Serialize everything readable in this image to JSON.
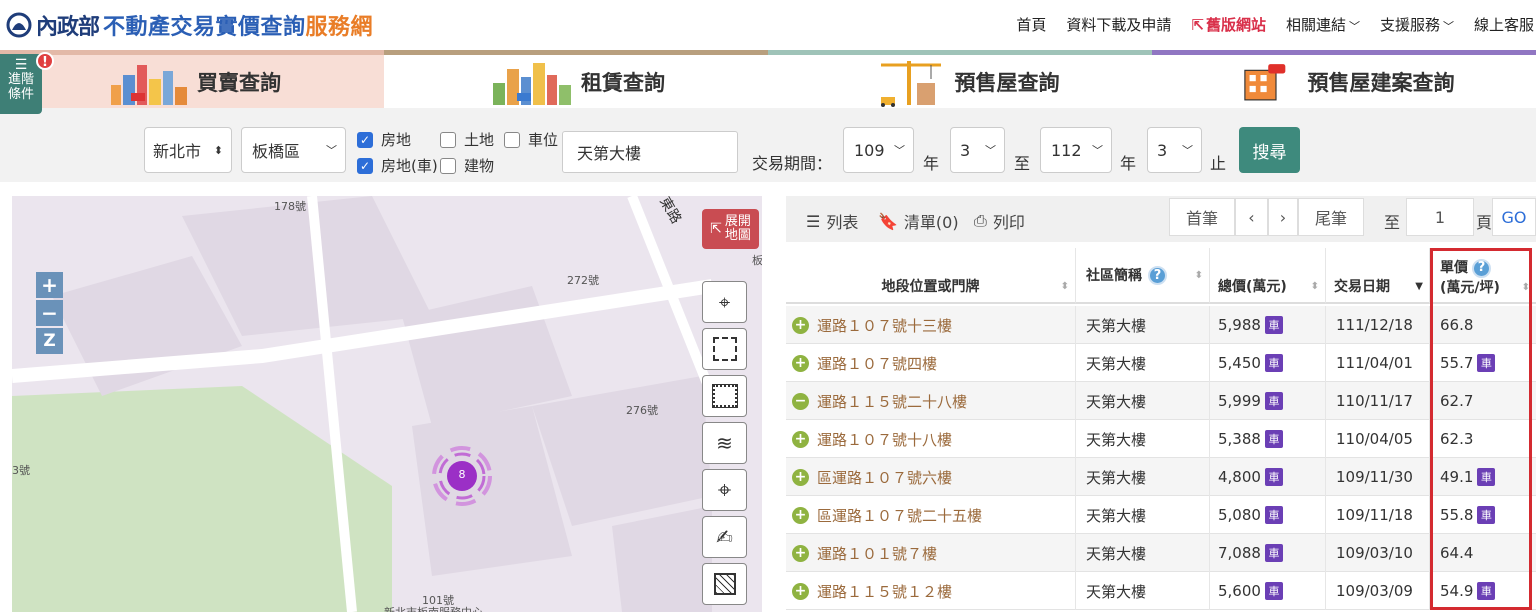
{
  "header": {
    "ministry": "內政部",
    "title_main": "不動產交易實價查詢",
    "title_accent": "服務網",
    "nav": {
      "home": "首頁",
      "download": "資料下載及申請",
      "old_site": "舊版網站",
      "links": "相關連結",
      "support": "支援服務",
      "service": "線上客服"
    }
  },
  "tabs": [
    {
      "label": "買賣查詢"
    },
    {
      "label": "租賃查詢"
    },
    {
      "label": "預售屋查詢"
    },
    {
      "label": "預售屋建案查詢"
    }
  ],
  "filter_button": {
    "label_line1": "進階",
    "label_line2": "條件",
    "badge": "!"
  },
  "search": {
    "city": "新北市",
    "district": "板橋區",
    "types": [
      {
        "label": "房地",
        "checked": true
      },
      {
        "label": "土地",
        "checked": false
      },
      {
        "label": "車位",
        "checked": false
      },
      {
        "label": "房地(車)",
        "checked": true
      },
      {
        "label": "建物",
        "checked": false
      }
    ],
    "keyword": "天第大樓",
    "period_label": "交易期間：",
    "start_year": "109",
    "start_month": "3",
    "end_year": "112",
    "end_month": "3",
    "year_unit": "年",
    "to": "至",
    "end": "止",
    "search_button": "搜尋"
  },
  "map": {
    "expand_label_1": "展開",
    "expand_label_2": "地圖",
    "zoom_in": "+",
    "zoom_out": "−",
    "zoom_z": "Z",
    "cluster_count": "8",
    "labels": {
      "l178": "178號",
      "l272": "272號",
      "l276": "276號",
      "l3": "3號",
      "l101": "101號",
      "road": "東路",
      "ban": "板",
      "bottom": "新北市板南服務中心"
    }
  },
  "panel": {
    "list": "列表",
    "bookmark": "清單(0)",
    "print": "列印",
    "first": "首筆",
    "prev": "‹",
    "next": "›",
    "last": "尾筆",
    "to": "至",
    "page": "1",
    "page_unit": "頁",
    "go": "GO"
  },
  "table": {
    "headers": {
      "address": "地段位置或門牌",
      "community": "社區簡稱",
      "total": "總價(萬元)",
      "date": "交易日期",
      "unit_line1": "單價",
      "unit_line2": "(萬元/坪)"
    },
    "car_label": "車",
    "rows": [
      {
        "address": "運路１０７號十三樓",
        "community": "天第大樓",
        "total": "5,988",
        "date": "111/12/18",
        "unit": "66.8",
        "unit_car": false,
        "minus": false
      },
      {
        "address": "運路１０７號四樓",
        "community": "天第大樓",
        "total": "5,450",
        "date": "111/04/01",
        "unit": "55.7",
        "unit_car": true,
        "minus": false
      },
      {
        "address": "運路１１５號二十八樓",
        "community": "天第大樓",
        "total": "5,999",
        "date": "110/11/17",
        "unit": "62.7",
        "unit_car": false,
        "minus": true
      },
      {
        "address": "運路１０７號十八樓",
        "community": "天第大樓",
        "total": "5,388",
        "date": "110/04/05",
        "unit": "62.3",
        "unit_car": false,
        "minus": false
      },
      {
        "address": "區運路１０７號六樓",
        "community": "天第大樓",
        "total": "4,800",
        "date": "109/11/30",
        "unit": "49.1",
        "unit_car": true,
        "minus": false
      },
      {
        "address": "區運路１０７號二十五樓",
        "community": "天第大樓",
        "total": "5,080",
        "date": "109/11/18",
        "unit": "55.8",
        "unit_car": true,
        "minus": false
      },
      {
        "address": "運路１０１號７樓",
        "community": "天第大樓",
        "total": "7,088",
        "date": "109/03/10",
        "unit": "64.4",
        "unit_car": false,
        "minus": false
      },
      {
        "address": "運路１１５號１２樓",
        "community": "天第大樓",
        "total": "5,600",
        "date": "109/03/09",
        "unit": "54.9",
        "unit_car": true,
        "minus": false
      }
    ]
  }
}
